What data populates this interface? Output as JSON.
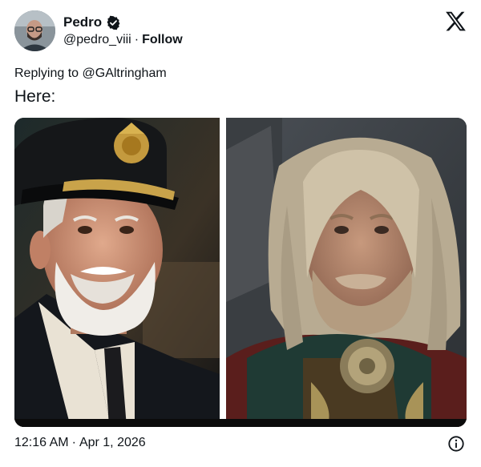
{
  "author": {
    "display_name": "Pedro",
    "handle": "@pedro_viii",
    "separator": "·",
    "follow_label": "Follow",
    "avatar_icon": "person-avatar",
    "verified_icon": "verified-badge-icon"
  },
  "brand": {
    "logo_icon": "x-logo-icon"
  },
  "tweet": {
    "reply_prefix": "Replying to",
    "reply_target": "@GAltringham",
    "text": "Here:",
    "media_description_left": "bearded captain in officer cap",
    "media_description_right": "long-haired king with cloak brooch"
  },
  "footer": {
    "time": "12:16 AM",
    "separator": "·",
    "date": "Apr 1, 2026",
    "info_icon": "info-icon"
  },
  "colors": {
    "text": "#0f1419",
    "verified": "#0f1419"
  }
}
